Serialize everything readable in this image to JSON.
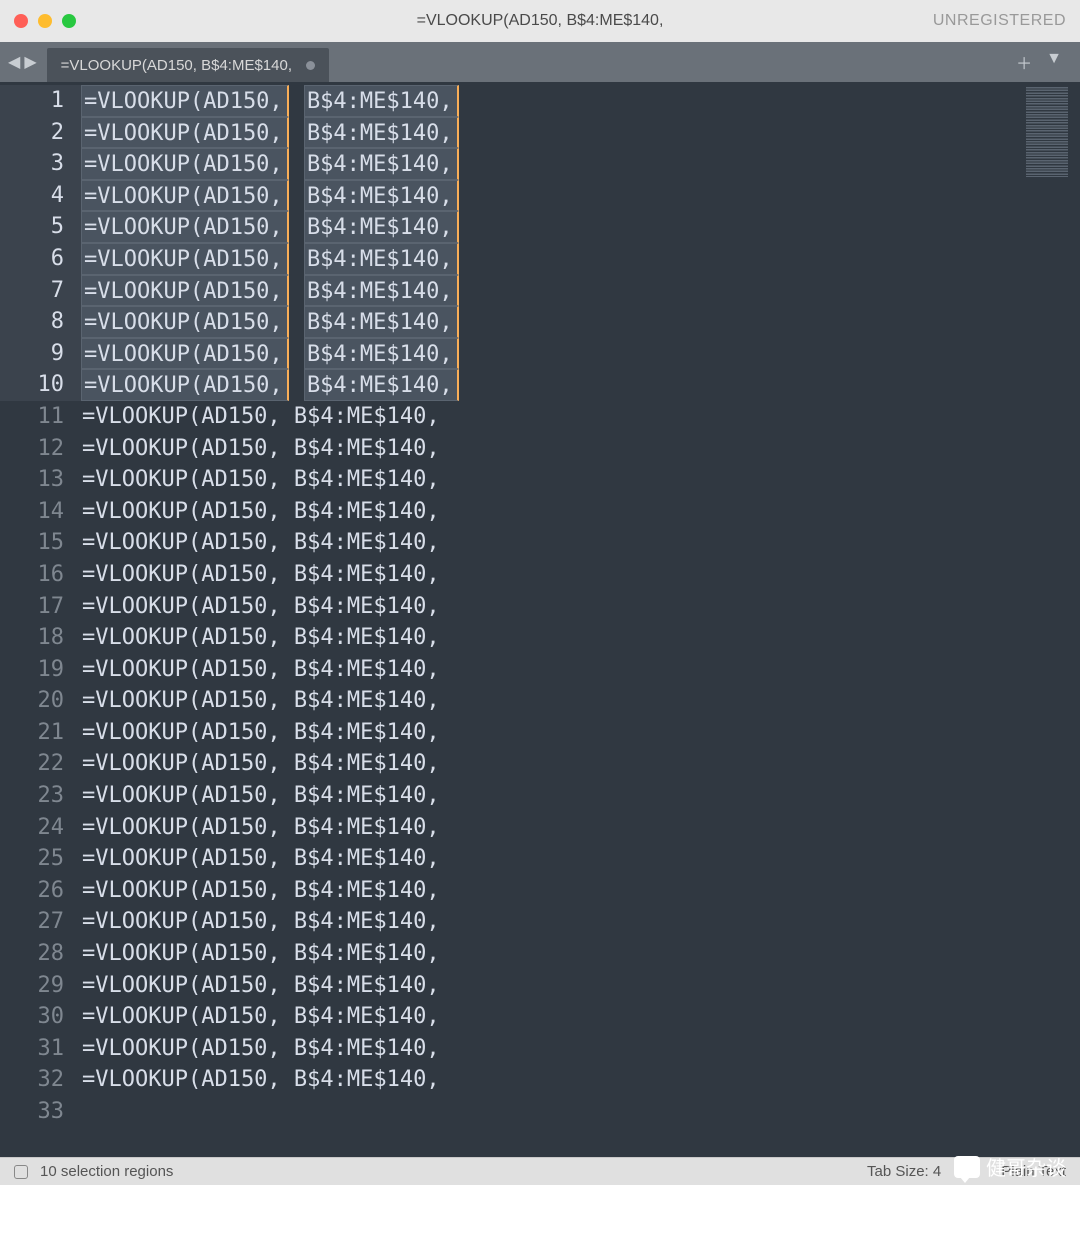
{
  "window": {
    "title": "=VLOOKUP(AD150, B$4:ME$140,",
    "registration_status": "UNREGISTERED"
  },
  "tab": {
    "label": "=VLOOKUP(AD150, B$4:ME$140,",
    "dirty": true
  },
  "editor": {
    "total_lines": 33,
    "selected_line_count": 10,
    "line_text_template": "=VLOOKUP(AD150, B$4:ME$140,",
    "sel_parts": [
      "=VLOOKUP(AD150,",
      "B$4:ME$140,"
    ],
    "lines": [
      {
        "num": 1,
        "text": "=VLOOKUP(AD150, B$4:ME$140,",
        "selected": true
      },
      {
        "num": 2,
        "text": "=VLOOKUP(AD150, B$4:ME$140,",
        "selected": true
      },
      {
        "num": 3,
        "text": "=VLOOKUP(AD150, B$4:ME$140,",
        "selected": true
      },
      {
        "num": 4,
        "text": "=VLOOKUP(AD150, B$4:ME$140,",
        "selected": true
      },
      {
        "num": 5,
        "text": "=VLOOKUP(AD150, B$4:ME$140,",
        "selected": true
      },
      {
        "num": 6,
        "text": "=VLOOKUP(AD150, B$4:ME$140,",
        "selected": true
      },
      {
        "num": 7,
        "text": "=VLOOKUP(AD150, B$4:ME$140,",
        "selected": true
      },
      {
        "num": 8,
        "text": "=VLOOKUP(AD150, B$4:ME$140,",
        "selected": true
      },
      {
        "num": 9,
        "text": "=VLOOKUP(AD150, B$4:ME$140,",
        "selected": true
      },
      {
        "num": 10,
        "text": "=VLOOKUP(AD150, B$4:ME$140,",
        "selected": true
      },
      {
        "num": 11,
        "text": "=VLOOKUP(AD150, B$4:ME$140,",
        "selected": false
      },
      {
        "num": 12,
        "text": "=VLOOKUP(AD150, B$4:ME$140,",
        "selected": false
      },
      {
        "num": 13,
        "text": "=VLOOKUP(AD150, B$4:ME$140,",
        "selected": false
      },
      {
        "num": 14,
        "text": "=VLOOKUP(AD150, B$4:ME$140,",
        "selected": false
      },
      {
        "num": 15,
        "text": "=VLOOKUP(AD150, B$4:ME$140,",
        "selected": false
      },
      {
        "num": 16,
        "text": "=VLOOKUP(AD150, B$4:ME$140,",
        "selected": false
      },
      {
        "num": 17,
        "text": "=VLOOKUP(AD150, B$4:ME$140,",
        "selected": false
      },
      {
        "num": 18,
        "text": "=VLOOKUP(AD150, B$4:ME$140,",
        "selected": false
      },
      {
        "num": 19,
        "text": "=VLOOKUP(AD150, B$4:ME$140,",
        "selected": false
      },
      {
        "num": 20,
        "text": "=VLOOKUP(AD150, B$4:ME$140,",
        "selected": false
      },
      {
        "num": 21,
        "text": "=VLOOKUP(AD150, B$4:ME$140,",
        "selected": false
      },
      {
        "num": 22,
        "text": "=VLOOKUP(AD150, B$4:ME$140,",
        "selected": false
      },
      {
        "num": 23,
        "text": "=VLOOKUP(AD150, B$4:ME$140,",
        "selected": false
      },
      {
        "num": 24,
        "text": "=VLOOKUP(AD150, B$4:ME$140,",
        "selected": false
      },
      {
        "num": 25,
        "text": "=VLOOKUP(AD150, B$4:ME$140,",
        "selected": false
      },
      {
        "num": 26,
        "text": "=VLOOKUP(AD150, B$4:ME$140,",
        "selected": false
      },
      {
        "num": 27,
        "text": "=VLOOKUP(AD150, B$4:ME$140,",
        "selected": false
      },
      {
        "num": 28,
        "text": "=VLOOKUP(AD150, B$4:ME$140,",
        "selected": false
      },
      {
        "num": 29,
        "text": "=VLOOKUP(AD150, B$4:ME$140,",
        "selected": false
      },
      {
        "num": 30,
        "text": "=VLOOKUP(AD150, B$4:ME$140,",
        "selected": false
      },
      {
        "num": 31,
        "text": "=VLOOKUP(AD150, B$4:ME$140,",
        "selected": false
      },
      {
        "num": 32,
        "text": "=VLOOKUP(AD150, B$4:ME$140,",
        "selected": false
      },
      {
        "num": 33,
        "text": "",
        "selected": false
      }
    ]
  },
  "status_bar": {
    "selection_info": "10 selection regions",
    "tab_size": "Tab Size: 4",
    "syntax": "Plain Text"
  },
  "watermark": {
    "text": "健哥杂谈"
  }
}
